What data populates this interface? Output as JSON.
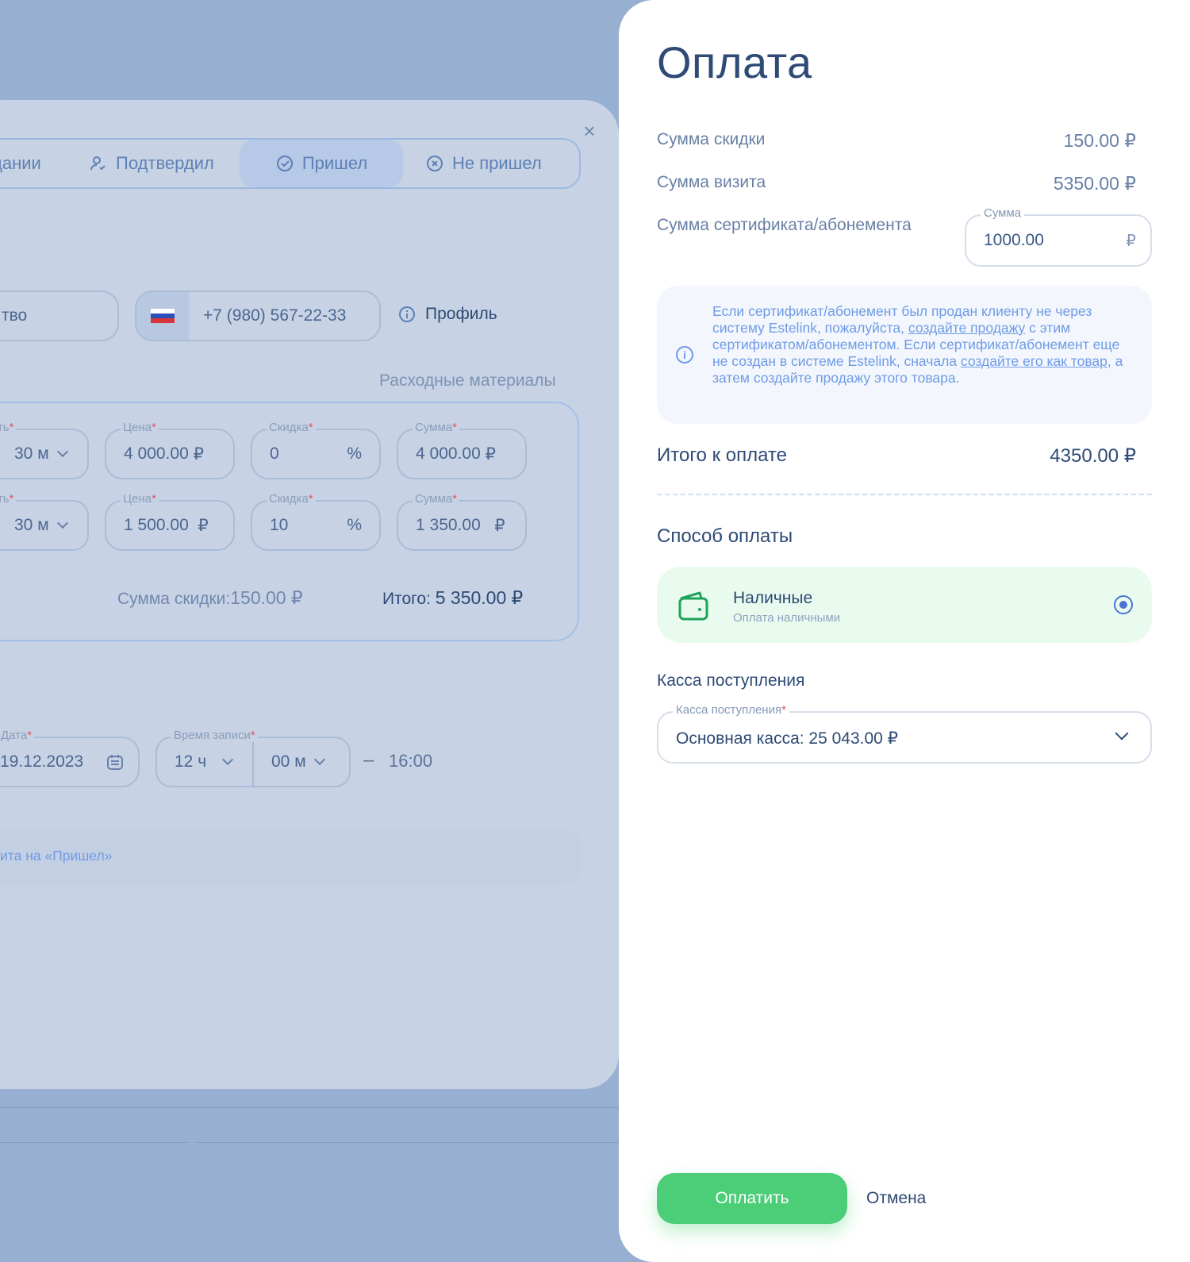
{
  "background": {
    "status_tabs": [
      {
        "label": "дании",
        "icon": "clock-icon"
      },
      {
        "label": "Подтвердил",
        "icon": "user-check-icon"
      },
      {
        "label": "Пришел",
        "icon": "check-circle-icon",
        "active": true
      },
      {
        "label": "Не пришел",
        "icon": "x-circle-icon"
      }
    ],
    "field_partial": "тво",
    "phone": "+7 (980) 567-22-33",
    "profile_label": "Профиль",
    "materials_label": "Расходные материалы",
    "service_rows": [
      {
        "duration_label": "ость",
        "duration": "30 м",
        "price_label": "Цена",
        "price": "4 000.00",
        "price_cur": "₽",
        "discount_label": "Скидка",
        "discount": "0",
        "discount_unit": "%",
        "sum_label": "Сумма",
        "sum": "4 000.00",
        "sum_cur": "₽"
      },
      {
        "duration_label": "ость",
        "duration": "30 м",
        "price_label": "Цена",
        "price": "1 500.00",
        "price_cur": "₽",
        "discount_label": "Скидка",
        "discount": "10",
        "discount_unit": "%",
        "sum_label": "Сумма",
        "sum": "1 350.00",
        "sum_cur": "₽"
      }
    ],
    "discount_summary_label": "Сумма скидки:",
    "discount_summary_value": "150.00 ₽",
    "total_summary_label": "Итого:",
    "total_summary_value": "5 350.00 ₽",
    "date_label": "Дата",
    "date": "19.12.2023",
    "time_label": "Время записи",
    "hour": "12 ч",
    "minute": "00 м",
    "dash": "–",
    "end_time": "16:00",
    "notice_partial": "ита на «Пришел»"
  },
  "payment": {
    "title": "Оплата",
    "discount_sum_label": "Сумма скидки",
    "discount_sum_value": "150.00 ₽",
    "visit_sum_label": "Сумма визита",
    "visit_sum_value": "5350.00 ₽",
    "cert_label": "Сумма сертификата/абонемента",
    "cert_field_label": "Сумма",
    "cert_field_value": "1000.00",
    "cert_currency": "₽",
    "info": {
      "t1": "Если сертификат/абонемент был продан клиенту не через систему Estelink, пожалуйста, ",
      "link1": "создайте продажу",
      "t2": " с этим сертификатом/абонементом. Если сертификат/абонемент еще не создан в системе Estelink, сначала ",
      "link2": "создайте его как товар",
      "t3": ", а затем создайте продажу этого товара."
    },
    "total_label": "Итого к оплате",
    "total_value": "4350.00 ₽",
    "method_section": "Способ оплаты",
    "method_name": "Наличные",
    "method_sub": "Оплата наличными",
    "cashbox_section": "Касса поступления",
    "cashbox_field_label": "Касса поступления",
    "cashbox_value": "Основная касса: 25 043.00 ₽",
    "pay_label": "Оплатить",
    "cancel_label": "Отмена"
  },
  "colors": {
    "accent_green": "#4ccd78",
    "title_blue": "#2e4a75",
    "info_blue": "#6f9be6",
    "method_bg": "#e9fbee",
    "radio": "#4a73d4"
  }
}
